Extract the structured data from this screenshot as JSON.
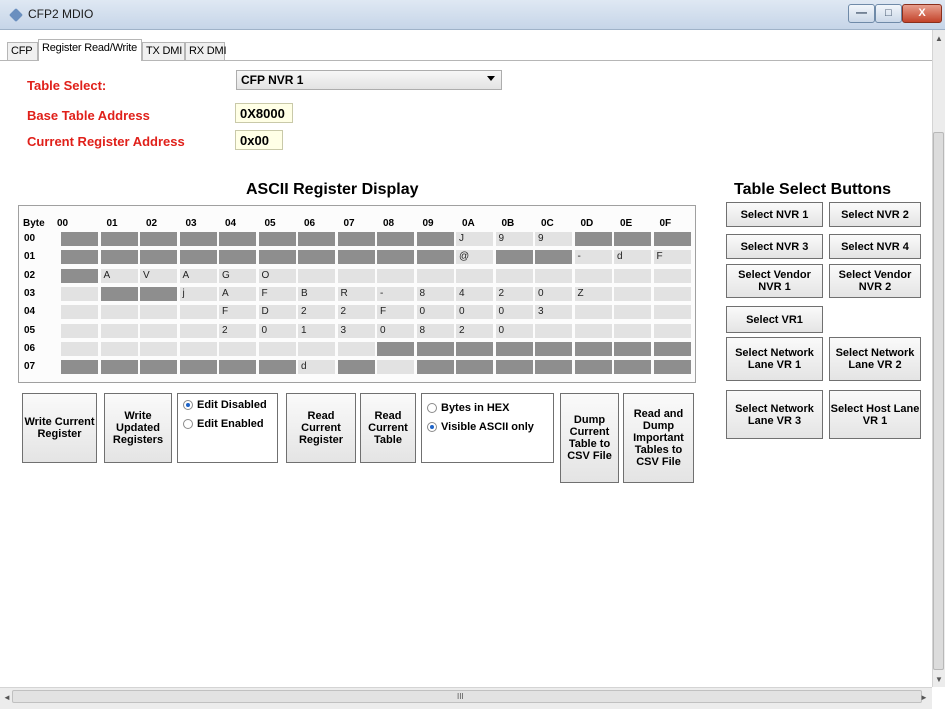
{
  "window": {
    "title": "CFP2 MDIO",
    "minimize": "—",
    "maximize": "□",
    "close": "X"
  },
  "tabs": [
    "CFP",
    "Register Read/Write",
    "TX DMI",
    "RX DMI"
  ],
  "form": {
    "table_select_label": "Table Select:",
    "table_select_value": "CFP NVR 1",
    "base_address_label": "Base Table Address",
    "base_address_value": "0X8000",
    "current_register_label": "Current Register Address",
    "current_register_value": "0x00"
  },
  "ascii_display": {
    "heading": "ASCII Register Display",
    "corner": "Byte",
    "col_headers": [
      "00",
      "01",
      "02",
      "03",
      "04",
      "05",
      "06",
      "07",
      "08",
      "09",
      "0A",
      "0B",
      "0C",
      "0D",
      "0E",
      "0F"
    ],
    "row_headers": [
      "00",
      "01",
      "02",
      "03",
      "04",
      "05",
      "06",
      "07"
    ],
    "rows": [
      [
        {
          "t": "",
          "d": 1
        },
        {
          "t": "",
          "d": 1
        },
        {
          "t": "",
          "d": 1
        },
        {
          "t": "",
          "d": 1
        },
        {
          "t": "",
          "d": 1
        },
        {
          "t": "",
          "d": 1
        },
        {
          "t": "",
          "d": 1
        },
        {
          "t": "",
          "d": 1
        },
        {
          "t": "",
          "d": 1
        },
        {
          "t": "",
          "d": 1
        },
        {
          "t": "J",
          "d": 0
        },
        {
          "t": "9",
          "d": 0
        },
        {
          "t": "9",
          "d": 0
        },
        {
          "t": "",
          "d": 1
        },
        {
          "t": "",
          "d": 1
        },
        {
          "t": "",
          "d": 1
        }
      ],
      [
        {
          "t": "",
          "d": 1
        },
        {
          "t": "",
          "d": 1
        },
        {
          "t": "",
          "d": 1
        },
        {
          "t": "",
          "d": 1
        },
        {
          "t": "",
          "d": 1
        },
        {
          "t": "",
          "d": 1
        },
        {
          "t": "",
          "d": 1
        },
        {
          "t": "",
          "d": 1
        },
        {
          "t": "",
          "d": 1
        },
        {
          "t": "",
          "d": 1
        },
        {
          "t": "@",
          "d": 0
        },
        {
          "t": "",
          "d": 1
        },
        {
          "t": "",
          "d": 1
        },
        {
          "t": "-",
          "d": 0
        },
        {
          "t": "d",
          "d": 0
        },
        {
          "t": "F",
          "d": 0
        }
      ],
      [
        {
          "t": "",
          "d": 1
        },
        {
          "t": "A",
          "d": 0
        },
        {
          "t": "V",
          "d": 0
        },
        {
          "t": "A",
          "d": 0
        },
        {
          "t": "G",
          "d": 0
        },
        {
          "t": "O",
          "d": 0
        },
        {
          "t": "",
          "d": 0
        },
        {
          "t": "",
          "d": 0
        },
        {
          "t": "",
          "d": 0
        },
        {
          "t": "",
          "d": 0
        },
        {
          "t": "",
          "d": 0
        },
        {
          "t": "",
          "d": 0
        },
        {
          "t": "",
          "d": 0
        },
        {
          "t": "",
          "d": 0
        },
        {
          "t": "",
          "d": 0
        },
        {
          "t": "",
          "d": 0
        }
      ],
      [
        {
          "t": "",
          "d": 0
        },
        {
          "t": "",
          "d": 1
        },
        {
          "t": "",
          "d": 1
        },
        {
          "t": "j",
          "d": 0
        },
        {
          "t": "A",
          "d": 0
        },
        {
          "t": "F",
          "d": 0
        },
        {
          "t": "B",
          "d": 0
        },
        {
          "t": "R",
          "d": 0
        },
        {
          "t": "-",
          "d": 0
        },
        {
          "t": "8",
          "d": 0
        },
        {
          "t": "4",
          "d": 0
        },
        {
          "t": "2",
          "d": 0
        },
        {
          "t": "0",
          "d": 0
        },
        {
          "t": "Z",
          "d": 0
        },
        {
          "t": "",
          "d": 0
        },
        {
          "t": "",
          "d": 0
        }
      ],
      [
        {
          "t": "",
          "d": 0
        },
        {
          "t": "",
          "d": 0
        },
        {
          "t": "",
          "d": 0
        },
        {
          "t": "",
          "d": 0
        },
        {
          "t": "F",
          "d": 0
        },
        {
          "t": "D",
          "d": 0
        },
        {
          "t": "2",
          "d": 0
        },
        {
          "t": "2",
          "d": 0
        },
        {
          "t": "F",
          "d": 0
        },
        {
          "t": "0",
          "d": 0
        },
        {
          "t": "0",
          "d": 0
        },
        {
          "t": "0",
          "d": 0
        },
        {
          "t": "3",
          "d": 0
        },
        {
          "t": "",
          "d": 0
        },
        {
          "t": "",
          "d": 0
        },
        {
          "t": "",
          "d": 0
        }
      ],
      [
        {
          "t": "",
          "d": 0
        },
        {
          "t": "",
          "d": 0
        },
        {
          "t": "",
          "d": 0
        },
        {
          "t": "",
          "d": 0
        },
        {
          "t": "2",
          "d": 0
        },
        {
          "t": "0",
          "d": 0
        },
        {
          "t": "1",
          "d": 0
        },
        {
          "t": "3",
          "d": 0
        },
        {
          "t": "0",
          "d": 0
        },
        {
          "t": "8",
          "d": 0
        },
        {
          "t": "2",
          "d": 0
        },
        {
          "t": "0",
          "d": 0
        },
        {
          "t": "",
          "d": 0
        },
        {
          "t": "",
          "d": 0
        },
        {
          "t": "",
          "d": 0
        },
        {
          "t": "",
          "d": 0
        }
      ],
      [
        {
          "t": "",
          "d": 0
        },
        {
          "t": "",
          "d": 0
        },
        {
          "t": "",
          "d": 0
        },
        {
          "t": "",
          "d": 0
        },
        {
          "t": "",
          "d": 0
        },
        {
          "t": "",
          "d": 0
        },
        {
          "t": "",
          "d": 0
        },
        {
          "t": "",
          "d": 0
        },
        {
          "t": "",
          "d": 1
        },
        {
          "t": "",
          "d": 1
        },
        {
          "t": "",
          "d": 1
        },
        {
          "t": "",
          "d": 1
        },
        {
          "t": "",
          "d": 1
        },
        {
          "t": "",
          "d": 1
        },
        {
          "t": "",
          "d": 1
        },
        {
          "t": "",
          "d": 1
        }
      ],
      [
        {
          "t": "",
          "d": 1
        },
        {
          "t": "",
          "d": 1
        },
        {
          "t": "",
          "d": 1
        },
        {
          "t": "",
          "d": 1
        },
        {
          "t": "",
          "d": 1
        },
        {
          "t": "",
          "d": 1
        },
        {
          "t": "d",
          "d": 0
        },
        {
          "t": "",
          "d": 1
        },
        {
          "t": "",
          "d": 0
        },
        {
          "t": "",
          "d": 1
        },
        {
          "t": "",
          "d": 1
        },
        {
          "t": "",
          "d": 1
        },
        {
          "t": "",
          "d": 1
        },
        {
          "t": "",
          "d": 1
        },
        {
          "t": "",
          "d": 1
        },
        {
          "t": "",
          "d": 1
        }
      ]
    ]
  },
  "actions": {
    "write_current": "Write Current Register",
    "write_updated": "Write Updated Registers",
    "edit_disabled": "Edit Disabled",
    "edit_enabled": "Edit Enabled",
    "read_register": "Read Current Register",
    "read_table": "Read Current Table",
    "bytes_hex": "Bytes in HEX",
    "visible_ascii": "Visible ASCII only",
    "dump_current": "Dump Current Table to CSV File",
    "dump_important": "Read and Dump Important Tables to CSV File"
  },
  "table_buttons": {
    "heading": "Table Select Buttons",
    "nvr1": "Select NVR 1",
    "nvr2": "Select NVR 2",
    "nvr3": "Select NVR 3",
    "nvr4": "Select NVR 4",
    "vendor1": "Select Vendor NVR 1",
    "vendor2": "Select Vendor NVR 2",
    "vr1": "Select VR1",
    "netlane1": "Select Network Lane VR 1",
    "netlane2": "Select Network Lane VR 2",
    "netlane3": "Select Network Lane VR 3",
    "hostlane1": "Select Host Lane VR 1"
  },
  "scrollbar": {
    "grip": "III",
    "left": "◄",
    "right": "►",
    "up": "▲",
    "down": "▼"
  },
  "colors": {
    "label_red": "#e0201a",
    "cell_dark": "#8e8e8e",
    "cell_light": "#e2e2e2",
    "field_bg": "#ffffe6"
  }
}
